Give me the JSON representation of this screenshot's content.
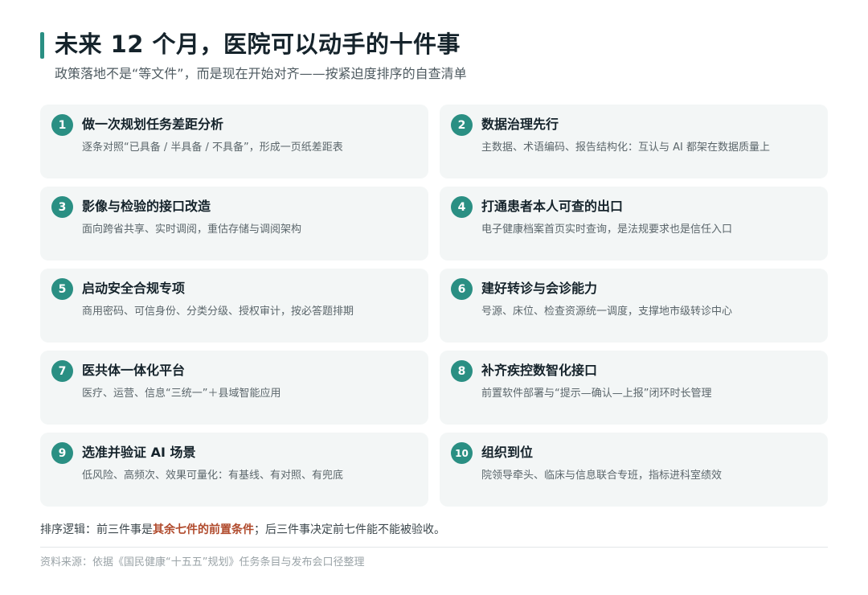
{
  "header": {
    "title": "未来 12 个月，医院可以动手的十件事",
    "subtitle": "政策落地不是“等文件”，而是现在开始对齐——按紧迫度排序的自查清单"
  },
  "items": [
    {
      "num": "1",
      "title": "做一次规划任务差距分析",
      "desc": "逐条对照“已具备 / 半具备 / 不具备”，形成一页纸差距表"
    },
    {
      "num": "2",
      "title": "数据治理先行",
      "desc": "主数据、术语编码、报告结构化：互认与 AI 都架在数据质量上"
    },
    {
      "num": "3",
      "title": "影像与检验的接口改造",
      "desc": "面向跨省共享、实时调阅，重估存储与调阅架构"
    },
    {
      "num": "4",
      "title": "打通患者本人可查的出口",
      "desc": "电子健康档案首页实时查询，是法规要求也是信任入口"
    },
    {
      "num": "5",
      "title": "启动安全合规专项",
      "desc": "商用密码、可信身份、分类分级、授权审计，按必答题排期"
    },
    {
      "num": "6",
      "title": "建好转诊与会诊能力",
      "desc": "号源、床位、检查资源统一调度，支撑地市级转诊中心"
    },
    {
      "num": "7",
      "title": "医共体一体化平台",
      "desc": "医疗、运营、信息“三统一”＋县域智能应用"
    },
    {
      "num": "8",
      "title": "补齐疾控数智化接口",
      "desc": "前置软件部署与“提示—确认—上报”闭环时长管理"
    },
    {
      "num": "9",
      "title": "选准并验证 AI 场景",
      "desc": "低风险、高频次、效果可量化：有基线、有对照、有兜底"
    },
    {
      "num": "10",
      "title": "组织到位",
      "desc": "院领导牵头、临床与信息联合专班，指标进科室绩效"
    }
  ],
  "footer": {
    "logic_prefix": "排序逻辑：前三件事是",
    "logic_emphasis": "其余七件的前置条件",
    "logic_suffix": "；后三件事决定前七件能不能被验收。",
    "source": "资料来源：依据《国民健康“十五五”规划》任务条目与发布会口径整理"
  },
  "colors": {
    "accent": "#2a8f83",
    "emphasis": "#b04a2c",
    "card_bg": "#f3f6f6"
  }
}
